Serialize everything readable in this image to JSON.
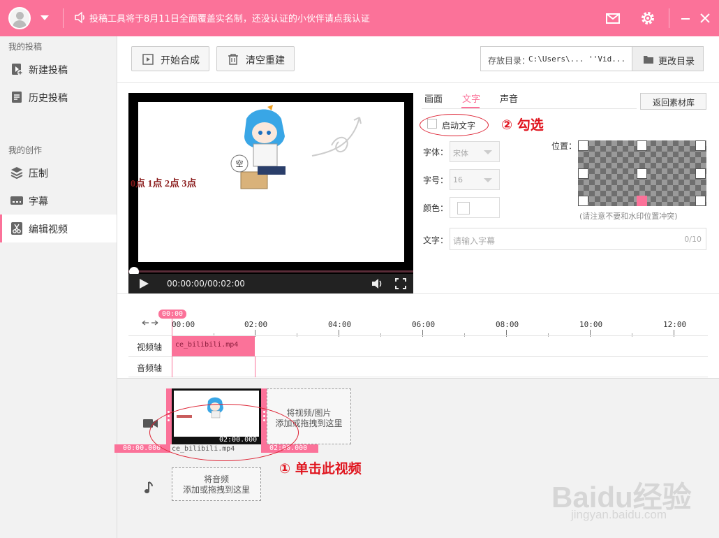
{
  "colors": {
    "accent": "#fb7299",
    "annotation": "#e0141e"
  },
  "titlebar": {
    "notice": "投稿工具将于8月11日全面覆盖实名制，还没认证的小伙伴请点我认证",
    "icons": [
      "mail-icon",
      "gear-icon",
      "minimize-icon",
      "close-icon"
    ]
  },
  "sidebar": {
    "group1": "我的投稿",
    "items1": [
      {
        "label": "新建投稿",
        "icon": "new-upload-icon"
      },
      {
        "label": "历史投稿",
        "icon": "history-icon"
      }
    ],
    "group2": "我的创作",
    "items2": [
      {
        "label": "压制",
        "icon": "layers-icon"
      },
      {
        "label": "字幕",
        "icon": "subtitle-icon"
      },
      {
        "label": "编辑视频",
        "icon": "scissors-icon",
        "active": true
      }
    ]
  },
  "toolbar": {
    "start_label": "开始合成",
    "clear_label": "清空重建",
    "path_label": "存放目录：",
    "path_value": "C:\\Users\\...  ''Vid...",
    "change_label": "更改目录"
  },
  "preview": {
    "overlay_text": "0点 1点 2点 3点",
    "bubble_text": "空",
    "time": "00:00:00/00:02:00",
    "progress": 0
  },
  "panel": {
    "tabs": [
      "画面",
      "文字",
      "声音"
    ],
    "active_tab": "文字",
    "back_label": "返回素材库",
    "enable_text_label": "启动文字",
    "enable_text_checked": false,
    "font_label": "字体：",
    "font_value": "宋体",
    "size_label": "字号：",
    "size_value": "16",
    "color_label": "颜色：",
    "position_label": "位置：",
    "position_hint": "(请注意不要和水印位置冲突)",
    "position_selected": "bottom-center",
    "text_label": "文字：",
    "text_placeholder": "请输入字幕",
    "text_counter": "0/10"
  },
  "annotations": {
    "step2": "② 勾选",
    "step1": "① 单击此视频"
  },
  "timeline": {
    "playhead": "00:00",
    "ticks": [
      "00:00",
      "02:00",
      "04:00",
      "06:00",
      "08:00",
      "10:00",
      "12:00"
    ],
    "video_track_label": "视频轴",
    "audio_track_label": "音频轴",
    "clip_name": "ce_bilibili.mp4"
  },
  "materials": {
    "video_duration": "02:00.000",
    "video_name": "ce_bilibili.mp4",
    "video_in": "00:00.000",
    "video_out": "02:00.000",
    "video_drop_line1": "将视频/图片",
    "video_drop_line2": "添加或拖拽到这里",
    "audio_drop_line1": "将音频",
    "audio_drop_line2": "添加或拖拽到这里"
  },
  "watermark": {
    "main": "Baidu经验",
    "sub": "jingyan.baidu.com"
  }
}
